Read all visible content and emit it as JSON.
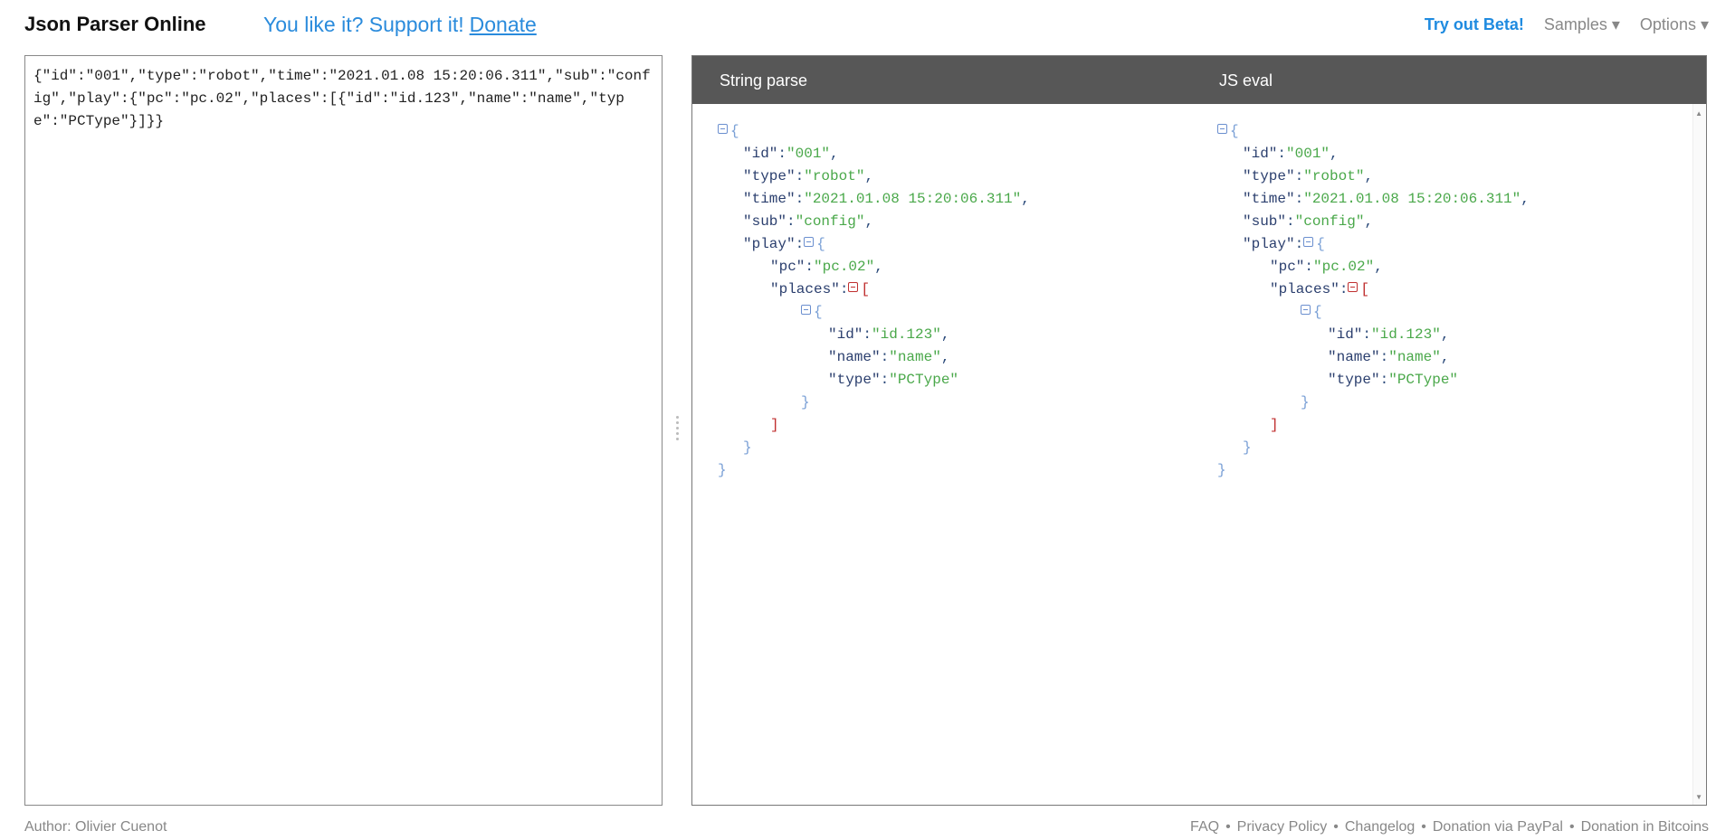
{
  "header": {
    "title": "Json Parser Online",
    "support_text": "You like it? Support it!",
    "donate_link": "Donate",
    "beta": "Try out Beta!",
    "samples": "Samples ▾",
    "options": "Options ▾"
  },
  "editor": {
    "value": "{\"id\":\"001\",\"type\":\"robot\",\"time\":\"2021.01.08 15:20:06.311\",\"sub\":\"config\",\"play\":{\"pc\":\"pc.02\",\"places\":[{\"id\":\"id.123\",\"name\":\"name\",\"type\":\"PCType\"}]}}"
  },
  "results": {
    "tab1": "String parse",
    "tab2": "JS eval",
    "tree": {
      "open_brace": "{",
      "close_brace": "}",
      "open_bracket": "[",
      "close_bracket": "]",
      "id_key": "\"id\"",
      "id_val": "\"001\"",
      "type_key": "\"type\"",
      "type_val": "\"robot\"",
      "time_key": "\"time\"",
      "time_val": "\"2021.01.08 15:20:06.311\"",
      "sub_key": "\"sub\"",
      "sub_val": "\"config\"",
      "play_key": "\"play\"",
      "pc_key": "\"pc\"",
      "pc_val": "\"pc.02\"",
      "places_key": "\"places\"",
      "pid_key": "\"id\"",
      "pid_val": "\"id.123\"",
      "name_key": "\"name\"",
      "name_val": "\"name\"",
      "ptype_key": "\"type\"",
      "ptype_val": "\"PCType\"",
      "colon": ":",
      "comma": ","
    }
  },
  "footer": {
    "author": "Author: Olivier Cuenot",
    "links": [
      "FAQ",
      "Privacy Policy",
      "Changelog",
      "Donation via PayPal",
      "Donation in Bitcoins"
    ],
    "separator": "•"
  }
}
